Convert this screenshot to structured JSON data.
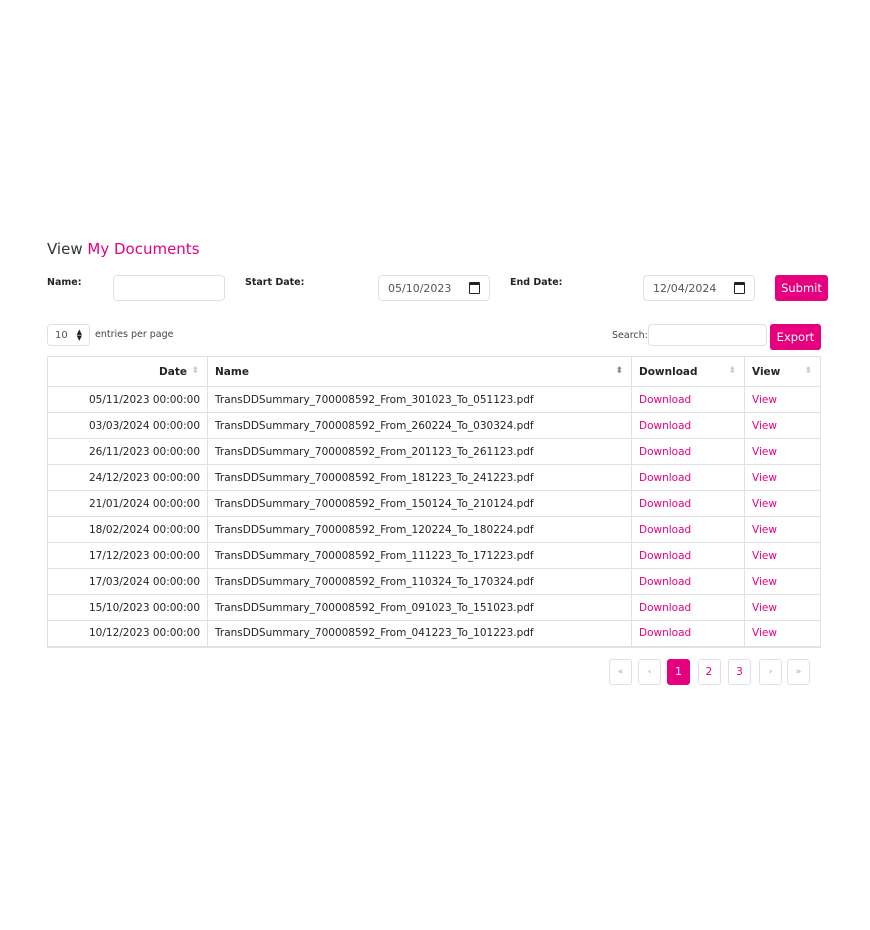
{
  "colors": {
    "accent": "#e6007e"
  },
  "title": {
    "prefix": "View",
    "accent": "My Documents"
  },
  "filters": {
    "name_label": "Name:",
    "name_value": "",
    "start_label": "Start Date:",
    "start_value": "05/10/2023",
    "end_label": "End Date:",
    "end_value": "12/04/2024",
    "submit": "Submit"
  },
  "controls": {
    "entries_value": "10",
    "entries_label": "entries per page",
    "search_label": "Search:",
    "search_value": "",
    "export": "Export"
  },
  "table": {
    "headers": [
      "Date",
      "Name",
      "Download",
      "View"
    ],
    "rows": [
      {
        "date": "05/11/2023 00:00:00",
        "name": "TransDDSummary_700008592_From_301023_To_051123.pdf",
        "download": "Download",
        "view": "View"
      },
      {
        "date": "03/03/2024 00:00:00",
        "name": "TransDDSummary_700008592_From_260224_To_030324.pdf",
        "download": "Download",
        "view": "View"
      },
      {
        "date": "26/11/2023 00:00:00",
        "name": "TransDDSummary_700008592_From_201123_To_261123.pdf",
        "download": "Download",
        "view": "View"
      },
      {
        "date": "24/12/2023 00:00:00",
        "name": "TransDDSummary_700008592_From_181223_To_241223.pdf",
        "download": "Download",
        "view": "View"
      },
      {
        "date": "21/01/2024 00:00:00",
        "name": "TransDDSummary_700008592_From_150124_To_210124.pdf",
        "download": "Download",
        "view": "View"
      },
      {
        "date": "18/02/2024 00:00:00",
        "name": "TransDDSummary_700008592_From_120224_To_180224.pdf",
        "download": "Download",
        "view": "View"
      },
      {
        "date": "17/12/2023 00:00:00",
        "name": "TransDDSummary_700008592_From_111223_To_171223.pdf",
        "download": "Download",
        "view": "View"
      },
      {
        "date": "17/03/2024 00:00:00",
        "name": "TransDDSummary_700008592_From_110324_To_170324.pdf",
        "download": "Download",
        "view": "View"
      },
      {
        "date": "15/10/2023 00:00:00",
        "name": "TransDDSummary_700008592_From_091023_To_151023.pdf",
        "download": "Download",
        "view": "View"
      },
      {
        "date": "10/12/2023 00:00:00",
        "name": "TransDDSummary_700008592_From_041223_To_101223.pdf",
        "download": "Download",
        "view": "View"
      }
    ]
  },
  "pagination": {
    "first": "«",
    "prev": "‹",
    "pages": [
      "1",
      "2",
      "3"
    ],
    "current": "1",
    "next": "›",
    "last": "»"
  }
}
